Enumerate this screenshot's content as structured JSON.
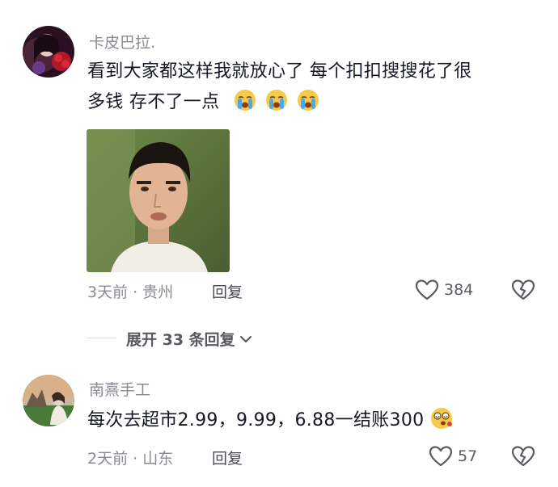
{
  "comments": [
    {
      "username": "卡皮巴拉.",
      "text_line1": "看到大家都这样我就放心了 每个扣扣搜搜花了很",
      "text_line2": "多钱 存不了一点",
      "emoji_count": 3,
      "emoji": "loudly-crying-face",
      "meta": "3天前 · 贵州",
      "reply_label": "回复",
      "like_count": "384"
    },
    {
      "username": "南熹手工",
      "text": "每次去超市2.99，9.99，6.88一结账300",
      "emoji": "face-with-spiral-eyes",
      "meta": "2天前 · 山东",
      "reply_label": "回复",
      "like_count": "57"
    }
  ],
  "expand_replies_label": "展开 33 条回复",
  "colors": {
    "text": "#161823",
    "muted": "#8a8b91",
    "background": "#ffffff"
  }
}
